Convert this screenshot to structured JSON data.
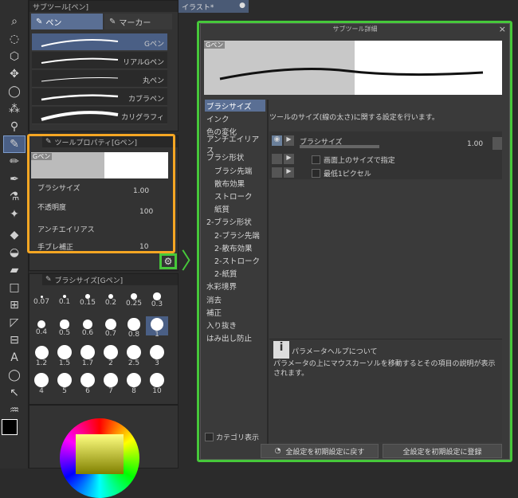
{
  "canvas_tab": {
    "title": "イラスト*"
  },
  "subtool_panel": {
    "title": "サブツール[ペン]",
    "tabs": [
      {
        "label": "ペン"
      },
      {
        "label": "マーカー"
      }
    ],
    "brushes": [
      {
        "name": "Gペン"
      },
      {
        "name": "リアルGペン"
      },
      {
        "name": "丸ペン"
      },
      {
        "name": "カブラペン"
      },
      {
        "name": "カリグラフィ"
      }
    ]
  },
  "tool_props": {
    "title": "ツールプロパティ[Gペン]",
    "preview_label": "Gペン",
    "rows": [
      {
        "label": "ブラシサイズ",
        "value": "1.00"
      },
      {
        "label": "不透明度",
        "value": "100"
      },
      {
        "label": "アンチエイリアス"
      },
      {
        "label": "手ブレ補正",
        "value": "10"
      }
    ]
  },
  "brush_size_panel": {
    "title": "ブラシサイズ[Gペン]",
    "sizes": [
      "0.07",
      "0.1",
      "0.15",
      "0.2",
      "0.25",
      "0.3",
      "0.4",
      "0.5",
      "0.6",
      "0.7",
      "0.8",
      "1",
      "1.2",
      "1.5",
      "1.7",
      "2",
      "2.5",
      "3",
      "4",
      "5",
      "6",
      "7",
      "8",
      "10"
    ]
  },
  "arrow": "〉",
  "detail": {
    "title": "サブツール詳細",
    "preview_label": "Gペン",
    "categories": [
      "ブラシサイズ",
      "インク",
      "色の変化",
      "アンチエイリアス",
      "ブラシ形状",
      "ブラシ先端",
      "散布効果",
      "ストローク",
      "紙質",
      "2-ブラシ形状",
      "2-ブラシ先端",
      "2-散布効果",
      "2-ストローク",
      "2-紙質",
      "水彩境界",
      "消去",
      "補正",
      "入り抜き",
      "はみ出し防止"
    ],
    "description": "ツールのサイズ(線の太さ)に関する設定を行います。",
    "setting": {
      "label": "ブラシサイズ",
      "value": "1.00"
    },
    "options": [
      "画面上のサイズで指定",
      "最低1ピクセル"
    ],
    "help_title": "パラメータヘルプについて",
    "help_text": "パラメータの上にマウスカーソルを移動するとその項目の説明が表示されます。",
    "category_view": "カテゴリ表示",
    "reset_button": "全設定を初期設定に戻す",
    "save_button": "全設定を初期設定に登録"
  }
}
